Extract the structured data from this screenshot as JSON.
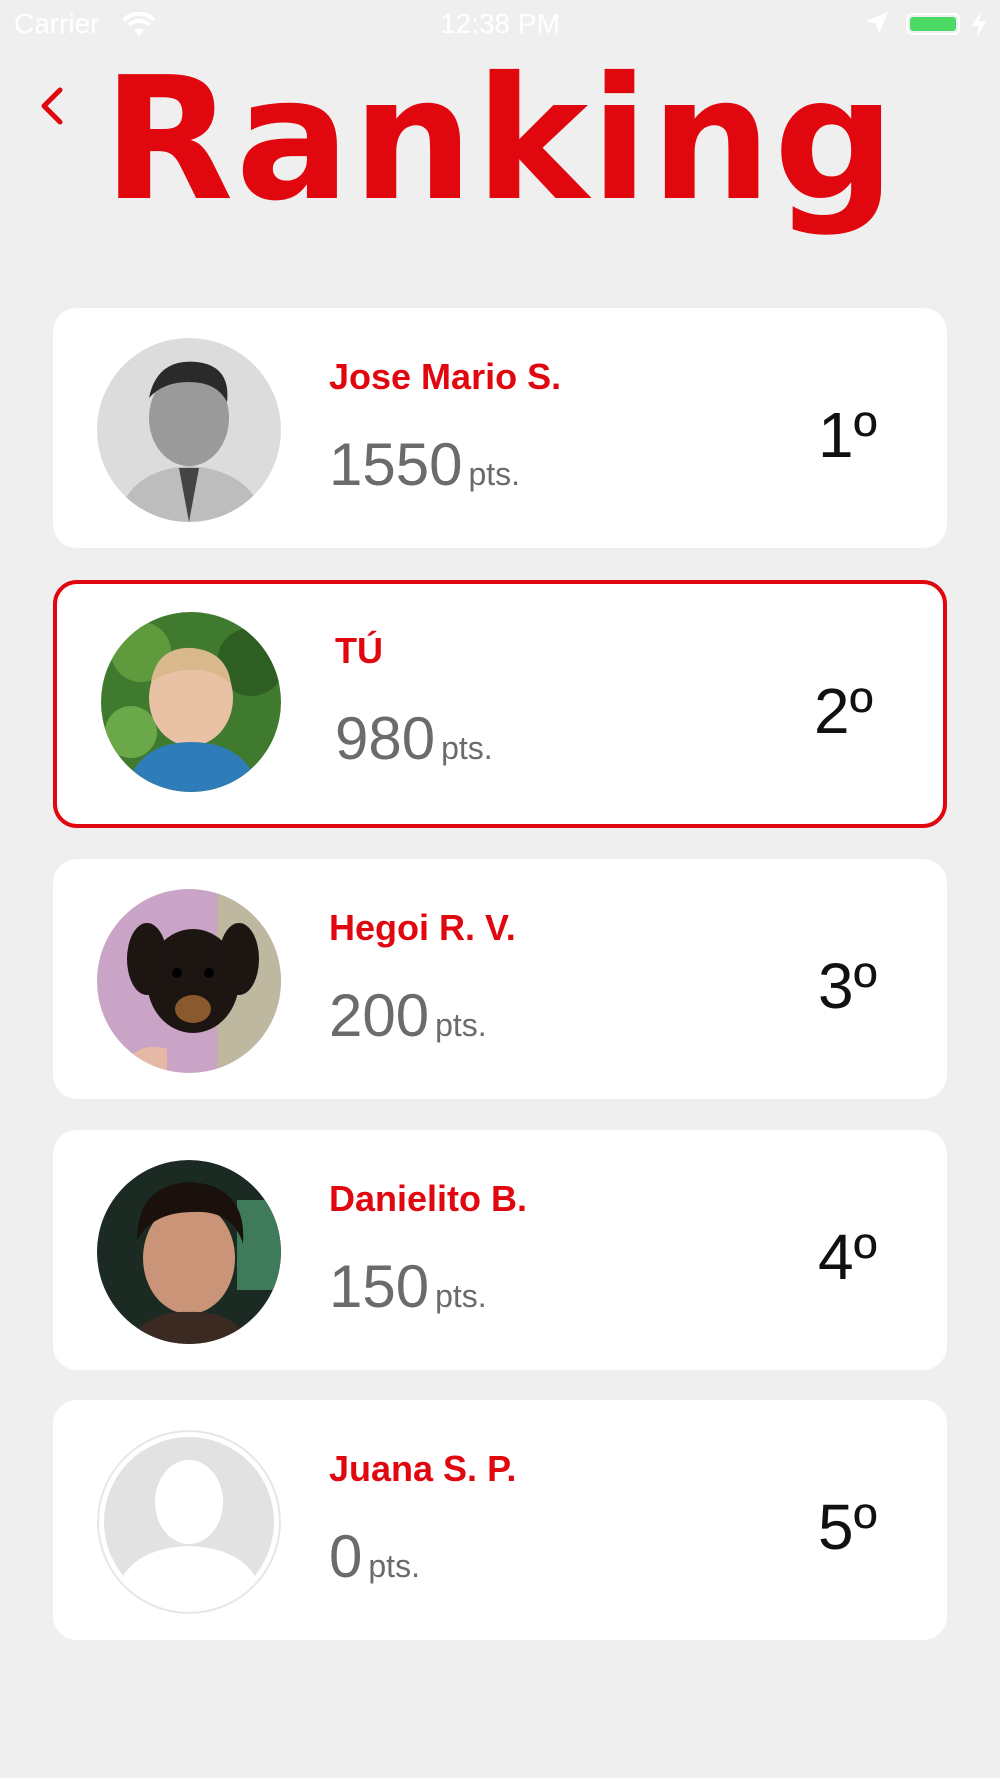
{
  "status_bar": {
    "carrier": "Carrier",
    "time": "12:38 PM",
    "battery_color": "#4cd964"
  },
  "header": {
    "title": "Ranking",
    "back_icon": "chevron-left-icon"
  },
  "accent_color": "#e0070f",
  "ranking": [
    {
      "name": "Jose Mario S.",
      "points": "1550",
      "unit": "pts.",
      "position": "1º"
    },
    {
      "name": "TÚ",
      "points": "980",
      "unit": "pts.",
      "position": "2º"
    },
    {
      "name": "Hegoi R. V.",
      "points": "200",
      "unit": "pts.",
      "position": "3º"
    },
    {
      "name": "Danielito B.",
      "points": "150",
      "unit": "pts.",
      "position": "4º"
    },
    {
      "name": "Juana S. P.",
      "points": "0",
      "unit": "pts.",
      "position": "5º"
    }
  ]
}
